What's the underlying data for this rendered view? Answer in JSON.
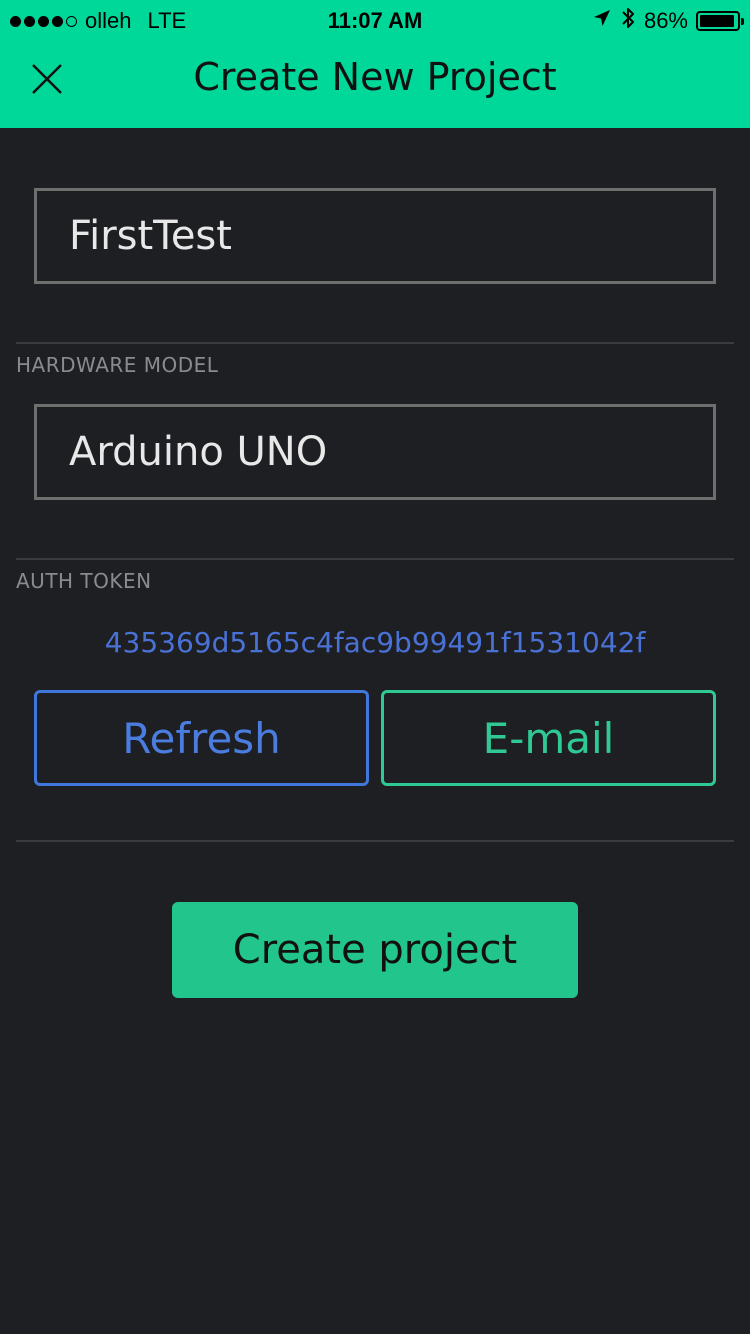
{
  "status_bar": {
    "carrier": "olleh",
    "network": "LTE",
    "time": "11:07 AM",
    "battery": "86%",
    "signal_filled": 4,
    "signal_total": 5,
    "icons": [
      "location-arrow-icon",
      "bluetooth-icon",
      "battery-icon"
    ]
  },
  "header": {
    "title": "Create New Project",
    "close_icon": "close-icon"
  },
  "project": {
    "name_value": "FirstTest"
  },
  "hardware": {
    "label": "HARDWARE MODEL",
    "value": "Arduino UNO"
  },
  "auth": {
    "label": "AUTH TOKEN",
    "token": "435369d5165c4fac9b99491f1531042f",
    "refresh_label": "Refresh",
    "email_label": "E-mail"
  },
  "actions": {
    "create_label": "Create project"
  },
  "colors": {
    "accent": "#00d89a",
    "background": "#1e1f23",
    "refresh": "#3f77dd",
    "email": "#2fc993",
    "create": "#22c58b"
  }
}
